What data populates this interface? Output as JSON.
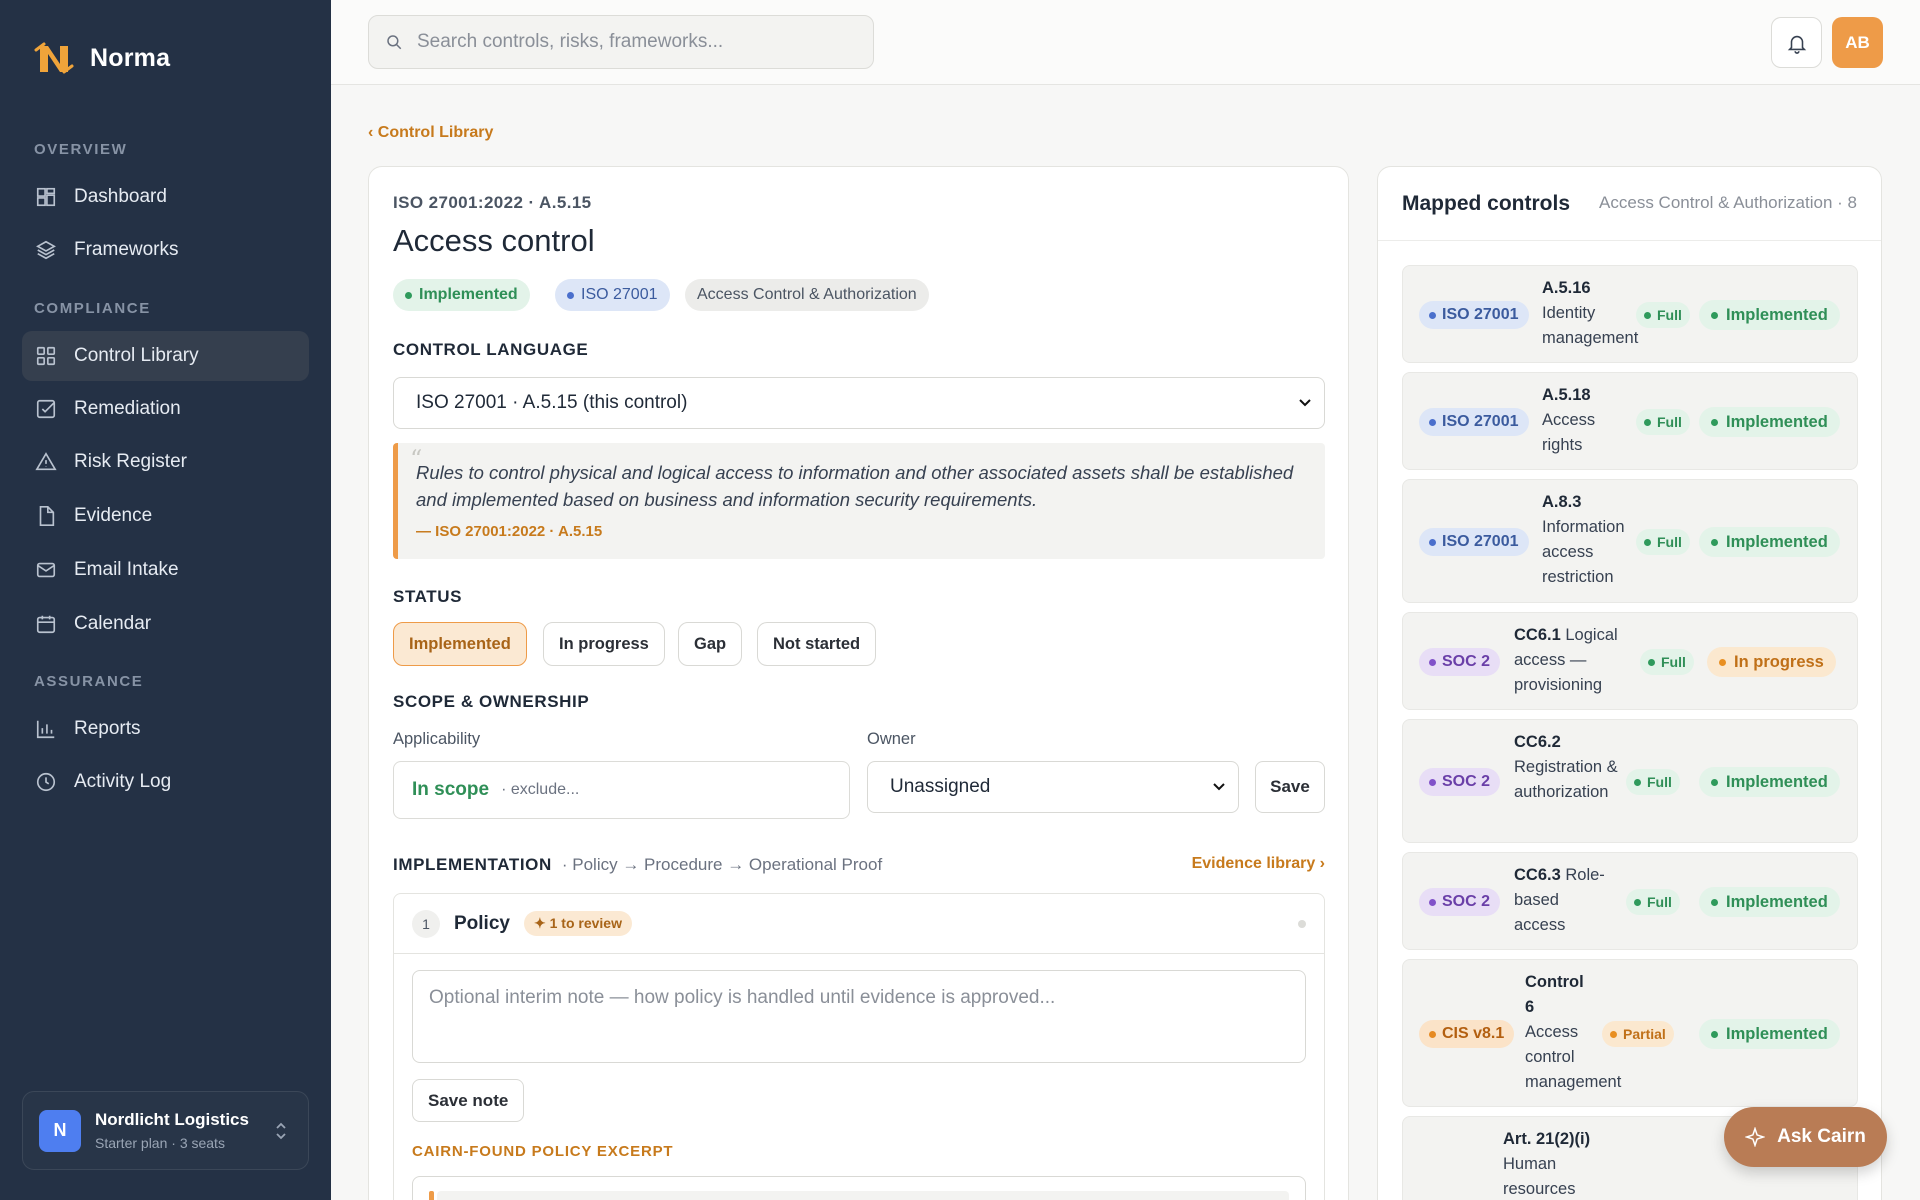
{
  "app": {
    "name": "Norma"
  },
  "colors": {
    "accent": "#ee9b48",
    "sidebar_bg": "#243145",
    "link": "#c77a1c"
  },
  "sidebar": {
    "sections": [
      {
        "label": "OVERVIEW"
      },
      {
        "label": "COMPLIANCE"
      },
      {
        "label": "ASSURANCE"
      }
    ],
    "items": [
      {
        "label": "Dashboard",
        "icon": "dashboard-icon"
      },
      {
        "label": "Frameworks",
        "icon": "layers-icon"
      },
      {
        "label": "Control Library",
        "icon": "grid-icon",
        "active": true
      },
      {
        "label": "Remediation",
        "icon": "check-square-icon"
      },
      {
        "label": "Risk Register",
        "icon": "warning-icon"
      },
      {
        "label": "Evidence",
        "icon": "file-icon"
      },
      {
        "label": "Email Intake",
        "icon": "mail-icon"
      },
      {
        "label": "Calendar",
        "icon": "calendar-icon"
      },
      {
        "label": "Reports",
        "icon": "bar-chart-icon"
      },
      {
        "label": "Activity Log",
        "icon": "clock-icon"
      }
    ],
    "org": {
      "initial": "N",
      "name": "Nordlicht Logistics",
      "plan": "Starter plan · 3 seats"
    }
  },
  "topbar": {
    "search_placeholder": "Search controls, risks, frameworks...",
    "user_initials": "AB"
  },
  "breadcrumb": "‹ Control Library",
  "control": {
    "ref": "ISO 27001:2022 · A.5.15",
    "title": "Access control",
    "tags": {
      "status": "Implemented",
      "framework": "ISO 27001",
      "domain": "Access Control & Authorization"
    },
    "language_label": "CONTROL LANGUAGE",
    "language_value": "ISO 27001 · A.5.15 (this control)",
    "quote": "Rules to control physical and logical access to information and other associated assets shall be established and implemented based on business and information security requirements.",
    "quote_source": "— ISO 27001:2022 · A.5.15",
    "status_label": "STATUS",
    "status_options": [
      "Implemented",
      "In progress",
      "Gap",
      "Not started"
    ],
    "status_selected": "Implemented",
    "scope_label": "SCOPE & OWNERSHIP",
    "applicability_label": "Applicability",
    "applicability_value": "In scope",
    "applicability_hint": "· exclude...",
    "owner_label": "Owner",
    "owner_value": "Unassigned",
    "save_label": "Save",
    "impl_label": "IMPLEMENTATION",
    "impl_sub": "· Policy → Procedure → Operational Proof",
    "evidence_link": "Evidence library ›",
    "policy": {
      "step": "1",
      "title": "Policy",
      "review_badge": "✦ 1 to review",
      "note_placeholder": "Optional interim note — how policy is handled until evidence is approved...",
      "save_note": "Save note",
      "excerpt_label": "CAIRN-FOUND POLICY EXCERPT"
    }
  },
  "mapped": {
    "title": "Mapped controls",
    "subtitle": "Access Control & Authorization · 8",
    "rows": [
      {
        "fw": "ISO 27001",
        "fw_type": "iso",
        "id": "A.5.16",
        "name": "Identity management",
        "coverage": "Full",
        "status": "Implemented"
      },
      {
        "fw": "ISO 27001",
        "fw_type": "iso",
        "id": "A.5.18",
        "name": "Access rights",
        "coverage": "Full",
        "status": "Implemented"
      },
      {
        "fw": "ISO 27001",
        "fw_type": "iso",
        "id": "A.8.3",
        "name": "Information access restriction",
        "coverage": "Full",
        "status": "Implemented"
      },
      {
        "fw": "SOC 2",
        "fw_type": "soc",
        "id": "CC6.1",
        "name": "Logical access — provisioning",
        "coverage": "Full",
        "status": "In progress"
      },
      {
        "fw": "SOC 2",
        "fw_type": "soc",
        "id": "CC6.2",
        "name": "Registration & authorization",
        "coverage": "Full",
        "status": "Implemented"
      },
      {
        "fw": "SOC 2",
        "fw_type": "soc",
        "id": "CC6.3",
        "name": "Role-based access",
        "coverage": "Full",
        "status": "Implemented"
      },
      {
        "fw": "CIS v8.1",
        "fw_type": "cis",
        "id": "Control 6",
        "name": "Access control management",
        "coverage": "Partial",
        "status": "Implemented"
      },
      {
        "fw": "",
        "fw_type": "",
        "id": "Art. 21(2)(i)",
        "name": "Human resources",
        "coverage": "",
        "status": ""
      }
    ]
  },
  "ask_cairn": "Ask Cairn"
}
